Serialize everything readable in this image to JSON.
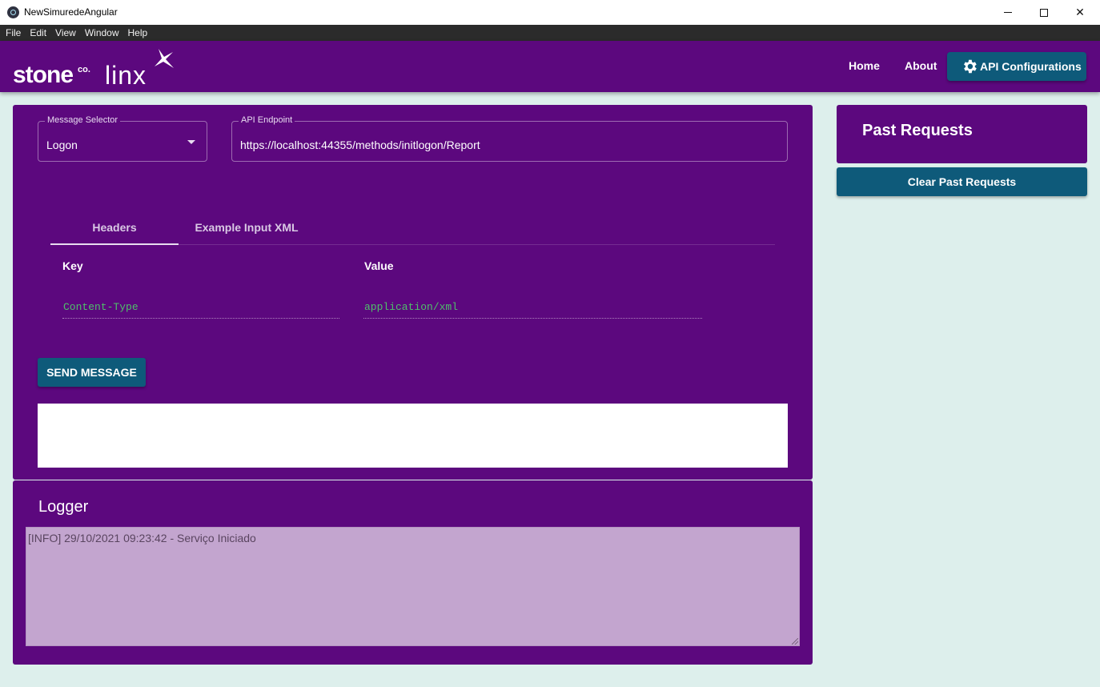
{
  "window": {
    "title": "NewSimuredeAngular",
    "minimize_icon": "minimize-icon",
    "maximize_icon": "maximize-icon",
    "close_glyph": "✕"
  },
  "menu": [
    "File",
    "Edit",
    "View",
    "Window",
    "Help"
  ],
  "brand": {
    "stone": "stone",
    "co": "co.",
    "linx": "linx",
    "colors": {
      "primary": "#5c087e",
      "accent": "#0e5a7a",
      "background": "#ddefec"
    }
  },
  "nav": {
    "home": "Home",
    "about": "About",
    "api_config": "API Configurations",
    "api_config_icon": "gear-icon"
  },
  "request": {
    "message_selector_label": "Message Selector",
    "message_selector_value": "Logon",
    "endpoint_label": "API Endpoint",
    "endpoint_value": "https://localhost:44355/methods/initlogon/Report",
    "tabs": [
      "Headers",
      "Example Input XML"
    ],
    "active_tab": "Headers",
    "columns": {
      "key": "Key",
      "value": "Value"
    },
    "headers": [
      {
        "key": "Content-Type",
        "value": "application/xml"
      }
    ],
    "send_label": "SEND MESSAGE",
    "response_text": ""
  },
  "logger": {
    "title": "Logger",
    "text": "[INFO] 29/10/2021 09:23:42 - Serviço Iniciado"
  },
  "past_requests": {
    "title": "Past Requests",
    "clear_label": "Clear Past Requests"
  }
}
